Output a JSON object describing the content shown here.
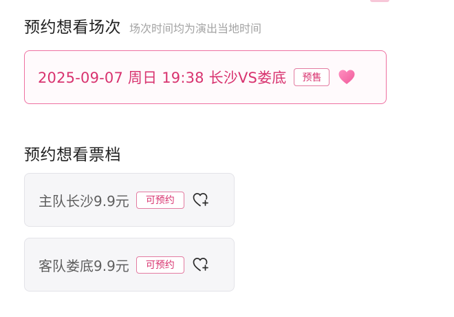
{
  "sessions_section": {
    "title": "预约想看场次",
    "note": "场次时间均为演出当地时间"
  },
  "session": {
    "text": "2025-09-07  周日 19:38  长沙VS娄底",
    "tag": "预售",
    "heart_icon": "heart-filled-icon",
    "accent_color": "#d8336f"
  },
  "tiers_section": {
    "title": "预约想看票档"
  },
  "tiers": [
    {
      "name": "主队长沙9.9元",
      "tag": "可预约",
      "icon": "heart-add-icon"
    },
    {
      "name": "客队娄底9.9元",
      "tag": "可预约",
      "icon": "heart-add-icon"
    }
  ]
}
